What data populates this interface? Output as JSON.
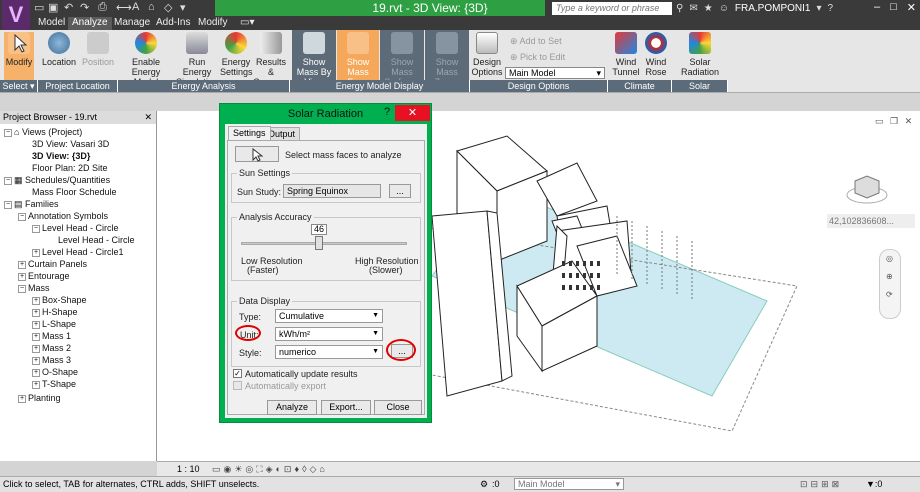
{
  "titlebar": {
    "logo": "V",
    "doc_title": "19.rvt - 3D View: {3D}",
    "search_placeholder": "Type a keyword or phrase",
    "user": "FRA.POMPONI1",
    "help": "?"
  },
  "menu": {
    "tabs": [
      "Model",
      "Analyze",
      "Manage",
      "Add-Ins",
      "Modify"
    ],
    "active": "Analyze"
  },
  "ribbon": {
    "buttons": [
      {
        "id": "modify",
        "label": "Modify"
      },
      {
        "id": "location",
        "label": "Location"
      },
      {
        "id": "position",
        "label": "Position"
      },
      {
        "id": "enable-energy-model",
        "label": "Enable Energy Model"
      },
      {
        "id": "run-energy-simulation",
        "label": "Run Energy Simulation"
      },
      {
        "id": "energy-settings",
        "label": "Energy Settings"
      },
      {
        "id": "results-compare",
        "label": "Results & Compare"
      },
      {
        "id": "show-mass-by-view",
        "label": "Show Mass By View"
      },
      {
        "id": "show-mass-form",
        "label": "Show Mass Form"
      },
      {
        "id": "show-mass-surfaces",
        "label": "Show Mass Surfaces"
      },
      {
        "id": "show-mass-zones",
        "label": "Show Mass Zones"
      },
      {
        "id": "design-options",
        "label": "Design Options"
      },
      {
        "id": "wind-tunnel",
        "label": "Wind Tunnel"
      },
      {
        "id": "wind-rose",
        "label": "Wind Rose"
      },
      {
        "id": "solar-radiation",
        "label": "Solar Radiation"
      }
    ],
    "add_to_set": "Add to Set",
    "pick_to_edit": "Pick to Edit",
    "main_model": "Main Model",
    "panels": [
      "Select ▾",
      "Project Location",
      "Energy Analysis",
      "Energy Model Display",
      "Design Options",
      "Climate Analysis",
      "Solar Analysis"
    ]
  },
  "browser": {
    "title": "Project Browser - 19.rvt",
    "items": [
      {
        "label": "Views (Project)"
      },
      {
        "label": "3D View: Vasari 3D"
      },
      {
        "label": "3D View: {3D}"
      },
      {
        "label": "Floor Plan: 2D Site"
      },
      {
        "label": "Schedules/Quantities"
      },
      {
        "label": "Mass Floor Schedule"
      },
      {
        "label": "Families"
      },
      {
        "label": "Annotation Symbols"
      },
      {
        "label": "Level Head - Circle"
      },
      {
        "label": "Level Head - Circle"
      },
      {
        "label": "Level Head - Circle1"
      },
      {
        "label": "Curtain Panels"
      },
      {
        "label": "Entourage"
      },
      {
        "label": "Mass"
      },
      {
        "label": "Box-Shape"
      },
      {
        "label": "H-Shape"
      },
      {
        "label": "L-Shape"
      },
      {
        "label": "Mass 1"
      },
      {
        "label": "Mass 2"
      },
      {
        "label": "Mass 3"
      },
      {
        "label": "O-Shape"
      },
      {
        "label": "T-Shape"
      },
      {
        "label": "Planting"
      }
    ]
  },
  "dialog": {
    "title": "Solar Radiation",
    "tabs": [
      "Settings",
      "Output"
    ],
    "select_faces": "Select mass faces to analyze",
    "sun_settings": "Sun Settings",
    "sun_study_label": "Sun Study:",
    "sun_study_value": "Spring Equinox",
    "analysis_accuracy": "Analysis Accuracy",
    "slider_value": "46",
    "low_res": "Low Resolution",
    "low_res_sub": "(Faster)",
    "high_res": "High Resolution",
    "high_res_sub": "(Slower)",
    "data_display": "Data Display",
    "type_label": "Type:",
    "type_value": "Cumulative",
    "unit_label": "Unit:",
    "unit_value": "kWh/m²",
    "style_label": "Style:",
    "style_value": "numerico",
    "ellipsis": "...",
    "auto_update": "Automatically update results",
    "auto_export": "Automatically export",
    "analyze": "Analyze",
    "export": "Export...",
    "close": "Close"
  },
  "viewport": {
    "coord_readout": "42,102836608..."
  },
  "viewbar": {
    "scale": "1 : 10"
  },
  "status": {
    "hint": "Click to select, TAB for alternates, CTRL adds, SHIFT unselects.",
    "model": "Main Model",
    "filter": ":0"
  }
}
